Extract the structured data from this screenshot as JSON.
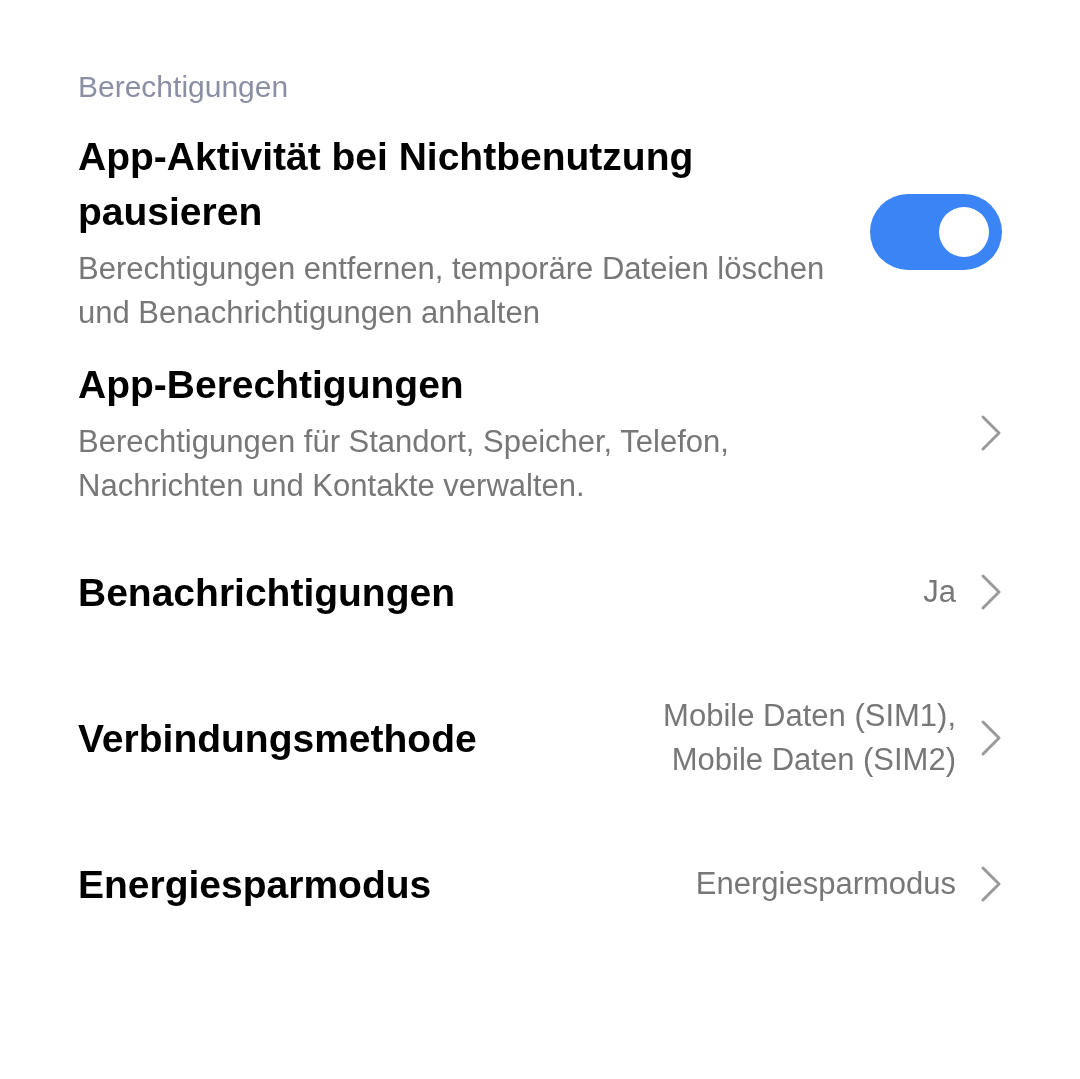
{
  "section_header": "Berechtigungen",
  "items": [
    {
      "kind": "toggle",
      "title": "App-Aktivität bei Nichtbenutzung pausieren",
      "subtitle": "Berechtigungen entfernen, temporäre Dateien löschen und Benachrichtigungen anhalten",
      "on": true
    },
    {
      "kind": "link",
      "title": "App-Berechtigungen",
      "subtitle": "Berechtigungen für Standort, Speicher, Telefon, Nachrichten und Kontakte verwalten."
    },
    {
      "kind": "link",
      "title": "Benachrichtigungen",
      "value": "Ja"
    },
    {
      "kind": "link",
      "title": "Verbindungsmethode",
      "value": "Mobile Daten (SIM1), Mobile Daten (SIM2)"
    },
    {
      "kind": "link",
      "title": "Energiesparmodus",
      "value": "Energiesparmodus"
    }
  ]
}
